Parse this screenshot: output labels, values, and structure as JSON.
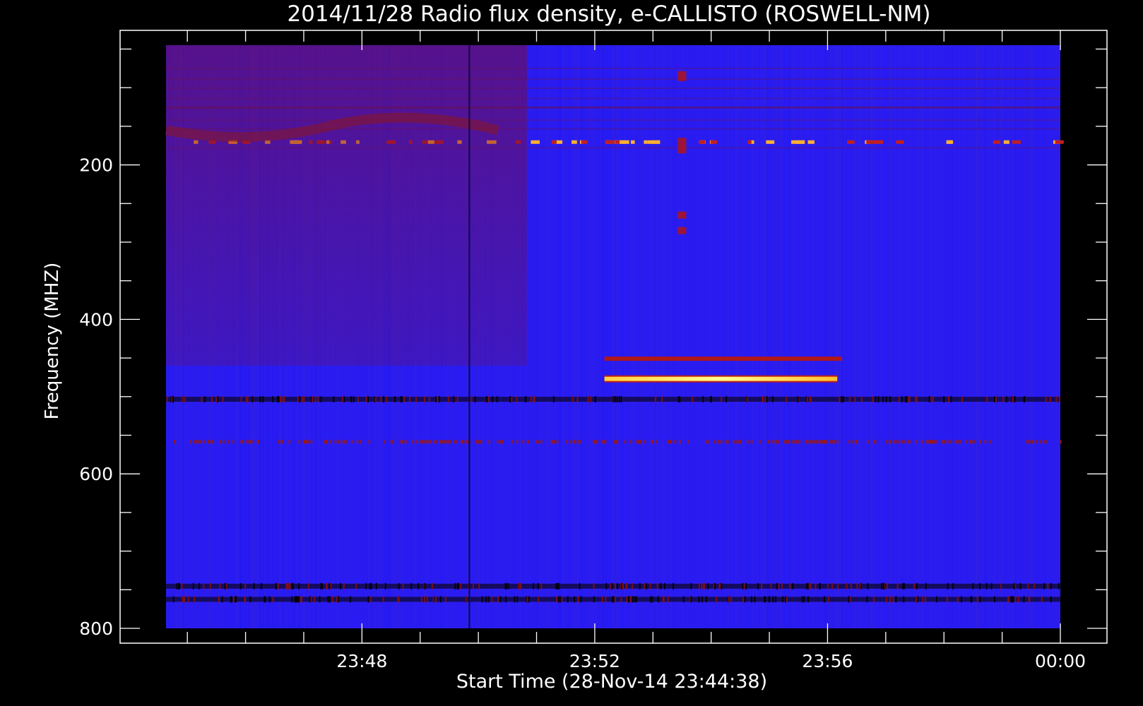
{
  "chart_data": {
    "type": "heatmap",
    "title": "2014/11/28  Radio flux density, e-CALLISTO (ROSWELL-NM)",
    "xlabel": "Start Time (28-Nov-14 23:44:38)",
    "ylabel": "Frequency (MHZ)",
    "x_unit": "minutes (UT)",
    "xlim": [
      "23:44:38",
      "00:00:00"
    ],
    "ylim": [
      45,
      800
    ],
    "y_inverted": true,
    "x_major_ticks": [
      "23:48",
      "23:52",
      "23:56",
      "00:00"
    ],
    "y_major_ticks": [
      200,
      400,
      600,
      800
    ],
    "colors": {
      "background_field": "#2a1cf0",
      "low": "#000000",
      "mid": "#8a1010",
      "high": "#ffff80"
    },
    "features": [
      {
        "kind": "bright_band",
        "freq_mhz": 477,
        "t_start": "23:52:10",
        "t_end": "23:56:10",
        "intensity": 1.0
      },
      {
        "kind": "band",
        "freq_mhz": 450,
        "t_start": "23:52:10",
        "t_end": "23:56:15",
        "intensity": 0.55
      },
      {
        "kind": "dotted_band",
        "freq_mhz": 170,
        "t_start": "23:45:00",
        "t_end": "00:00:00",
        "intensity": 0.8
      },
      {
        "kind": "dark_band",
        "freq_mhz": 503,
        "t_start": "23:45:00",
        "t_end": "00:00:00",
        "intensity": 0.2
      },
      {
        "kind": "dark_band",
        "freq_mhz": 745,
        "t_start": "23:45:00",
        "t_end": "00:00:00",
        "intensity": 0.1
      },
      {
        "kind": "dark_band",
        "freq_mhz": 762,
        "t_start": "23:45:00",
        "t_end": "00:00:00",
        "intensity": 0.05
      },
      {
        "kind": "red_band",
        "freq_mhz": 558,
        "t_start": "23:45:00",
        "t_end": "00:00:00",
        "intensity": 0.45
      },
      {
        "kind": "reddish_region",
        "freq_mhz_range": [
          45,
          460
        ],
        "t_start": "23:45:00",
        "t_end": "23:50:50",
        "intensity": 0.35
      },
      {
        "kind": "dark_vertical_line",
        "time": "23:49:50",
        "intensity": 0.05
      },
      {
        "kind": "burst_spots",
        "time": "23:53:30",
        "freq_mhz_range": [
          80,
          280
        ],
        "intensity": 0.6
      }
    ]
  }
}
